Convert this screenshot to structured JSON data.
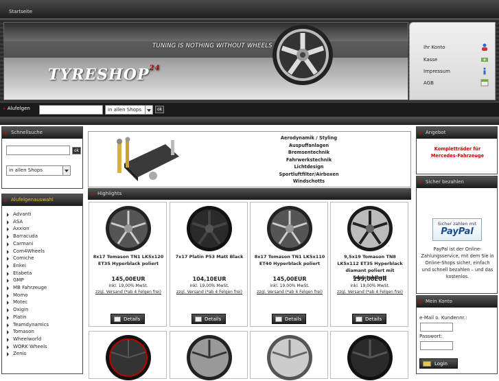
{
  "topbar": {
    "breadcrumb": "Startseite"
  },
  "header": {
    "slogan": "TUNING IS NOTHING WITHOUT WHEELS",
    "logo_text": "TYRESHOP",
    "logo_sup": "24",
    "account_links": [
      {
        "label": "Ihr Konto",
        "icon": "user-icon"
      },
      {
        "label": "Kasse",
        "icon": "cash-icon"
      },
      {
        "label": "Impressum",
        "icon": "info-icon"
      },
      {
        "label": "AGB",
        "icon": "document-icon"
      }
    ]
  },
  "search": {
    "label_prefix": "▸",
    "label": "Alufelgen",
    "value": "",
    "select": "in allen Shops",
    "ok": "ok"
  },
  "quicksearch": {
    "title": "Schnellsuche",
    "value": "",
    "ok": "ok",
    "select": "in allen Shops"
  },
  "manufacturers": {
    "title": "Alufelgenauswahl",
    "items": [
      "Advanti",
      "ASA",
      "Axxion",
      "Barracuda",
      "Carmani",
      "Com4Wheels",
      "Comiche",
      "Enkei",
      "Etabeta",
      "GMP",
      "MB Fahrzeuge",
      "Momo",
      "Motec",
      "Oxigin",
      "Platin",
      "Teamdynamics",
      "Tomason",
      "Wheelworld",
      "WORK Wheels",
      "Zenis"
    ]
  },
  "categories": [
    "Aerodynamik / Styling",
    "Auspuffanlagen",
    "Bremsentechnik",
    "Fahrwerkstechnik",
    "Lichtdesign",
    "Sportluftfilter/Airboxen",
    "Windschotts"
  ],
  "highlights": {
    "title": "Highlights",
    "products": [
      {
        "title": "8x17 Tomason TN1 LK5x120 ET35 Hyperblack poliert",
        "price": "145,00EUR",
        "tax": "inkl. 19,00% MwSt.",
        "ship": "zzgl. Versand (*ab 4 Felgen frei)",
        "details": "Details"
      },
      {
        "title": "7x17 Platin P53 Matt Black",
        "price": "104,10EUR",
        "tax": "inkl. 19,00% MwSt.",
        "ship": "zzgl. Versand (*ab 4 Felgen frei)",
        "details": "Details"
      },
      {
        "title": "8x17 Tomason TN1 LK5x110 ET40 Hyperblack poliert",
        "price": "145,00EUR",
        "tax": "inkl. 19,00% MwSt.",
        "ship": "zzgl. Versand (*ab 4 Felgen frei)",
        "details": "Details"
      },
      {
        "title": "9,5x19 Tomason TN8 LK5x112 ET35 Hyperblack diamant poliert mit Edelstahlbett",
        "price": "299,00EUR",
        "tax": "inkl. 19,00% MwSt.",
        "ship": "zzgl. Versand (*ab 4 Felgen frei)",
        "details": "Details"
      }
    ]
  },
  "offer": {
    "title": "Angebot",
    "text": "Kompletträder für Mercedes-Fahrzeuge"
  },
  "payment": {
    "title": "Sicher bezahlen",
    "badge_top": "Sicher zahlen mit",
    "badge_brand": "PayPal",
    "text": "PayPal ist der Online-Zahlungsservice, mit dem Sie in Online-Shops sicher, einfach und schnell bezahlen – und das kostenlos."
  },
  "login": {
    "title": "Mein Konto",
    "email_label": "e-Mail o. Kundennr.:",
    "password_label": "Passwort:",
    "button": "Login"
  },
  "colors": {
    "accent": "#cc0000",
    "dark": "#1a1a1a"
  }
}
